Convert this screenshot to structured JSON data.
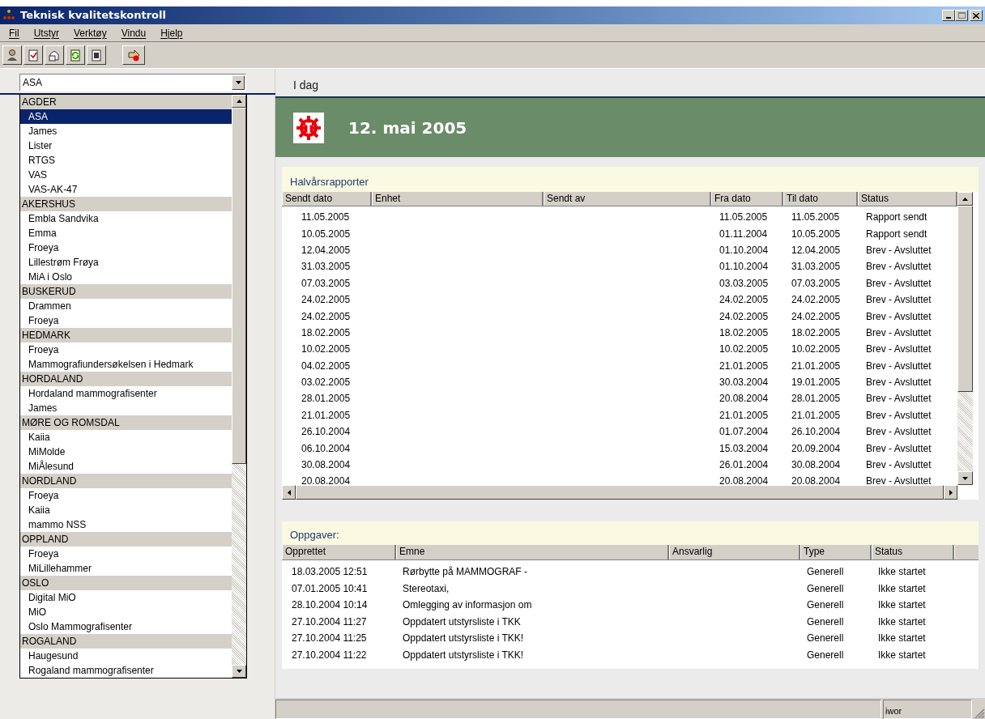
{
  "window": {
    "title": "Teknisk kvalitetskontroll"
  },
  "menu": [
    "Fil",
    "Utstyr",
    "Verktøy",
    "Vindu",
    "Hjelp"
  ],
  "unit_combo": {
    "value": "ASA"
  },
  "unit_list": [
    {
      "label": "AGDER",
      "items": [
        {
          "label": "ASA",
          "selected": true
        },
        {
          "label": "James",
          "selected": false
        },
        {
          "label": "Lister",
          "selected": false
        },
        {
          "label": "RTGS",
          "selected": false
        },
        {
          "label": "VAS",
          "selected": false
        },
        {
          "label": "VAS-AK-47",
          "selected": false
        }
      ]
    },
    {
      "label": "AKERSHUS",
      "items": [
        {
          "label": "Embla Sandvika",
          "selected": false
        },
        {
          "label": "Emma",
          "selected": false
        },
        {
          "label": "Froeya",
          "selected": false
        },
        {
          "label": "Lillestrøm Frøya",
          "selected": false
        },
        {
          "label": "MiA i Oslo",
          "selected": false
        }
      ]
    },
    {
      "label": "BUSKERUD",
      "items": [
        {
          "label": "Drammen",
          "selected": false
        },
        {
          "label": "Froeya",
          "selected": false
        }
      ]
    },
    {
      "label": "HEDMARK",
      "items": [
        {
          "label": "Froeya",
          "selected": false
        },
        {
          "label": "Mammografiundersøkelsen i Hedmark",
          "selected": false
        }
      ]
    },
    {
      "label": "HORDALAND",
      "items": [
        {
          "label": "Hordaland mammografisenter",
          "selected": false
        },
        {
          "label": "James",
          "selected": false
        }
      ]
    },
    {
      "label": "MØRE OG ROMSDAL",
      "items": [
        {
          "label": "Kaiia",
          "selected": false
        },
        {
          "label": "MiMolde",
          "selected": false
        },
        {
          "label": "MiÅlesund",
          "selected": false
        }
      ]
    },
    {
      "label": "NORDLAND",
      "items": [
        {
          "label": "Froeya",
          "selected": false
        },
        {
          "label": "Kaiia",
          "selected": false
        },
        {
          "label": "mammo NSS",
          "selected": false
        }
      ]
    },
    {
      "label": "OPPLAND",
      "items": [
        {
          "label": "Froeya",
          "selected": false
        },
        {
          "label": "MiLillehammer",
          "selected": false
        }
      ]
    },
    {
      "label": "OSLO",
      "items": [
        {
          "label": "Digital MiO",
          "selected": false
        },
        {
          "label": "MiO",
          "selected": false
        },
        {
          "label": "Oslo Mammografisenter",
          "selected": false
        }
      ]
    },
    {
      "label": "ROGALAND",
      "items": [
        {
          "label": "Haugesund",
          "selected": false
        },
        {
          "label": "Rogaland mammografisenter",
          "selected": false
        }
      ]
    }
  ],
  "tab": {
    "label": "I dag"
  },
  "banner": {
    "date": "12. mai 2005"
  },
  "reports": {
    "title": "Halvårsrapporter",
    "columns": [
      "Sendt dato",
      "Enhet",
      "Sendt av",
      "Fra dato",
      "Til dato",
      "Status"
    ],
    "rows": [
      {
        "sent": "11.05.2005",
        "from": "11.05.2005",
        "to": "11.05.2005",
        "status": "Rapport sendt"
      },
      {
        "sent": "10.05.2005",
        "from": "01.11.2004",
        "to": "10.05.2005",
        "status": "Rapport sendt"
      },
      {
        "sent": "12.04.2005",
        "from": "01.10.2004",
        "to": "12.04.2005",
        "status": "Brev - Avsluttet"
      },
      {
        "sent": "31.03.2005",
        "from": "01.10.2004",
        "to": "31.03.2005",
        "status": "Brev - Avsluttet"
      },
      {
        "sent": "07.03.2005",
        "from": "03.03.2005",
        "to": "07.03.2005",
        "status": "Brev - Avsluttet"
      },
      {
        "sent": "24.02.2005",
        "from": "24.02.2005",
        "to": "24.02.2005",
        "status": "Brev - Avsluttet"
      },
      {
        "sent": "24.02.2005",
        "from": "24.02.2005",
        "to": "24.02.2005",
        "status": "Brev - Avsluttet"
      },
      {
        "sent": "18.02.2005",
        "from": "18.02.2005",
        "to": "18.02.2005",
        "status": "Brev - Avsluttet"
      },
      {
        "sent": "10.02.2005",
        "from": "10.02.2005",
        "to": "10.02.2005",
        "status": "Brev - Avsluttet"
      },
      {
        "sent": "04.02.2005",
        "from": "21.01.2005",
        "to": "21.01.2005",
        "status": "Brev - Avsluttet"
      },
      {
        "sent": "03.02.2005",
        "from": "30.03.2004",
        "to": "19.01.2005",
        "status": "Brev - Avsluttet"
      },
      {
        "sent": "28.01.2005",
        "from": "20.08.2004",
        "to": "28.01.2005",
        "status": "Brev - Avsluttet"
      },
      {
        "sent": "21.01.2005",
        "from": "21.01.2005",
        "to": "21.01.2005",
        "status": "Brev - Avsluttet"
      },
      {
        "sent": "26.10.2004",
        "from": "01.07.2004",
        "to": "26.10.2004",
        "status": "Brev - Avsluttet"
      },
      {
        "sent": "06.10.2004",
        "from": "15.03.2004",
        "to": "20.09.2004",
        "status": "Brev - Avsluttet"
      },
      {
        "sent": "30.08.2004",
        "from": "26.01.2004",
        "to": "30.08.2004",
        "status": "Brev - Avsluttet"
      },
      {
        "sent": "20.08.2004",
        "from": "20.08.2004",
        "to": "20.08.2004",
        "status": "Brev - Avsluttet"
      }
    ]
  },
  "tasks": {
    "title": "Oppgaver:",
    "columns": [
      "Opprettet",
      "Emne",
      "Ansvarlig",
      "Type",
      "Status"
    ],
    "rows": [
      {
        "created": "18.03.2005 12:51",
        "subject": "Rørbytte på MAMMOGRAF -",
        "type": "Generell",
        "status": "Ikke startet"
      },
      {
        "created": "07.01.2005 10:41",
        "subject": "Stereotaxi,",
        "type": "Generell",
        "status": "Ikke startet"
      },
      {
        "created": "28.10.2004 10:14",
        "subject": "Omlegging av informasjon om",
        "type": "Generell",
        "status": "Ikke startet"
      },
      {
        "created": "27.10.2004 11:27",
        "subject": "Oppdatert utstyrsliste i TKK",
        "type": "Generell",
        "status": "Ikke startet"
      },
      {
        "created": "27.10.2004 11:25",
        "subject": "Oppdatert utstyrsliste i TKK!",
        "type": "Generell",
        "status": "Ikke startet"
      },
      {
        "created": "27.10.2004 11:22",
        "subject": "Oppdatert utstyrsliste i TKK!",
        "type": "Generell",
        "status": "Ikke startet"
      }
    ]
  },
  "status_bar": {
    "user": "iwor"
  }
}
